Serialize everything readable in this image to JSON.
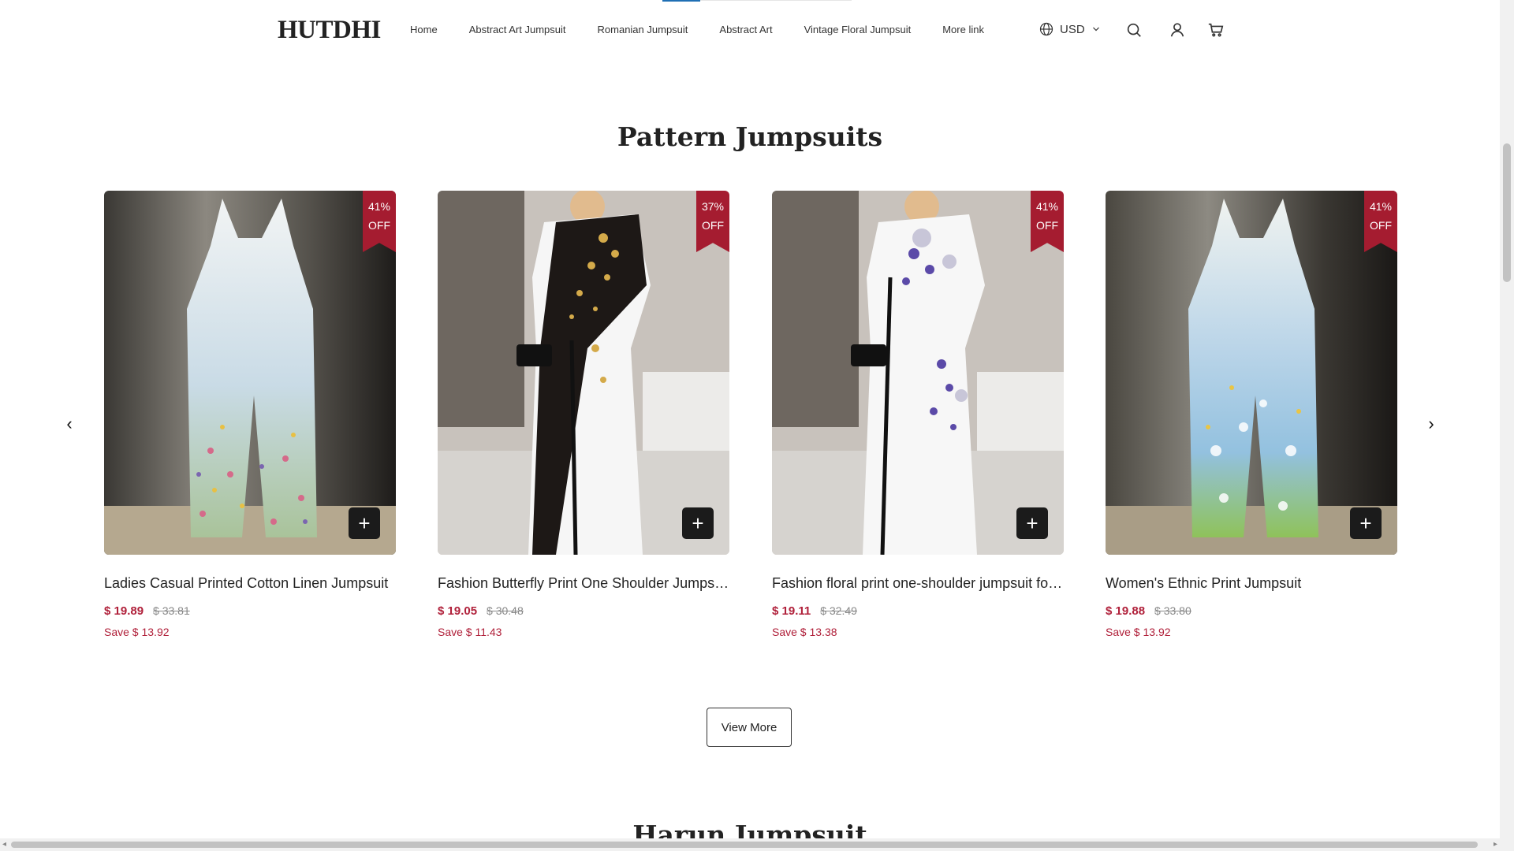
{
  "header": {
    "logo": "HUTDHI",
    "nav": [
      "Home",
      "Abstract Art Jumpsuit",
      "Romanian Jumpsuit",
      "Abstract Art",
      "Vintage Floral Jumpsuit",
      "More link"
    ],
    "currency": "USD",
    "icons": [
      "globe-icon",
      "chevron-down-icon",
      "search-icon",
      "user-icon",
      "cart-icon"
    ]
  },
  "section": {
    "title": "Pattern Jumpsuits",
    "view_more": "View More",
    "next_title": "Harun Jumpsuit"
  },
  "products": [
    {
      "title": "Ladies Casual Printed Cotton Linen Jumpsuit",
      "badge_pct": "41%",
      "badge_off": "OFF",
      "price": "$ 19.89",
      "old_price": "$ 33.81",
      "save": "Save $ 13.92"
    },
    {
      "title": "Fashion Butterfly Print One Shoulder Jumpsu…",
      "badge_pct": "37%",
      "badge_off": "OFF",
      "price": "$ 19.05",
      "old_price": "$ 30.48",
      "save": "Save $ 11.43"
    },
    {
      "title": "Fashion floral print one-shoulder jumpsuit fo…",
      "badge_pct": "41%",
      "badge_off": "OFF",
      "price": "$ 19.11",
      "old_price": "$ 32.49",
      "save": "Save $ 13.38"
    },
    {
      "title": "Women's Ethnic Print Jumpsuit",
      "badge_pct": "41%",
      "badge_off": "OFF",
      "price": "$ 19.88",
      "old_price": "$ 33.80",
      "save": "Save $ 13.92"
    }
  ],
  "colors": {
    "sale_red": "#b0203a",
    "badge_red": "#a51c30",
    "add_button": "#1b1b1b",
    "text": "#222222"
  }
}
